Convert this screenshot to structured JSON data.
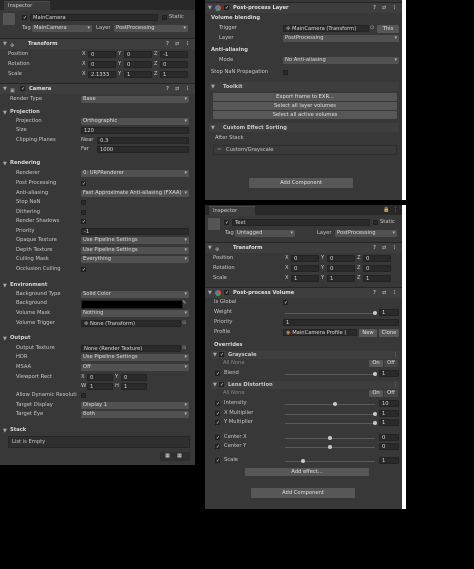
{
  "left": {
    "tab": "Inspector",
    "object": {
      "name": "MainCamera",
      "static": "Static",
      "tag_label": "Tag",
      "tag": "MainCamera",
      "layer_label": "Layer",
      "layer": "PostProcessing"
    },
    "transform": {
      "title": "Transform",
      "position": {
        "label": "Position",
        "x": "0",
        "y": "0",
        "z": "-1"
      },
      "rotation": {
        "label": "Rotation",
        "x": "0",
        "y": "0",
        "z": "0"
      },
      "scale": {
        "label": "Scale",
        "x": "2.1333",
        "y": "1",
        "z": "1"
      }
    },
    "camera": {
      "title": "Camera",
      "render_type_label": "Render Type",
      "render_type": "Base",
      "projection_header": "Projection",
      "projection_label": "Projection",
      "projection": "Orthographic",
      "size_label": "Size",
      "size": "120",
      "clipping_label": "Clipping Planes",
      "near_label": "Near",
      "near": "0.3",
      "far_label": "Far",
      "far": "1000",
      "rendering_header": "Rendering",
      "renderer_label": "Renderer",
      "renderer": "0: URPRenderer",
      "post_label": "Post Processing",
      "aa_label": "Anti-aliasing",
      "aa": "Fast Approximate Anti-aliasing (FXAA)",
      "stopnan_label": "Stop NaN",
      "dither_label": "Dithering",
      "shadows_label": "Render Shadows",
      "priority_label": "Priority",
      "priority": "-1",
      "opaque_label": "Opaque Texture",
      "opaque": "Use Pipeline Settings",
      "depth_label": "Depth Texture",
      "depth": "Use Pipeline Settings",
      "culling_label": "Culling Mask",
      "culling": "Everything",
      "occlusion_label": "Occlusion Culling",
      "environment_header": "Environment",
      "bgtype_label": "Background Type",
      "bgtype": "Solid Color",
      "bg_label": "Background",
      "volmask_label": "Volume Mask",
      "volmask": "Nothing",
      "voltrig_label": "Volume Trigger",
      "voltrig": "None (Transform)",
      "output_header": "Output",
      "outtex_label": "Output Texture",
      "outtex": "None (Render Texture)",
      "hdr_label": "HDR",
      "hdr": "Use Pipeline Settings",
      "msaa_label": "MSAA",
      "msaa": "Off",
      "viewport_label": "Viewport Rect",
      "vx": "0",
      "vy": "0",
      "vw": "1",
      "vh": "1",
      "allowdyn_label": "Allow Dynamic Resoluti",
      "tdisplay_label": "Target Display",
      "tdisplay": "Display 1",
      "teye_label": "Target Eye",
      "teye": "Both",
      "stack_header": "Stack",
      "stack_empty": "List is Empty"
    }
  },
  "right1": {
    "title": "Post-process Layer",
    "volume_blending": "Volume blending",
    "trigger_label": "Trigger",
    "trigger": "MainCamera (Transform)",
    "this_btn": "This",
    "layer_label": "Layer",
    "layer": "PostProcessing",
    "aa_header": "Anti-aliasing",
    "mode_label": "Mode",
    "mode": "No Anti-aliasing",
    "stopnan_label": "Stop NaN Propagation",
    "toolkit": "Toolkit",
    "export_btn": "Export frame to EXR...",
    "select_all_btn": "Select all layer volumes",
    "select_active_btn": "Select all active volumes",
    "custom_header": "Custom Effect Sorting",
    "after_stack": "After Stack",
    "grayscale": "Custom/Grayscale",
    "add_component": "Add Component"
  },
  "right2": {
    "tab": "Inspector",
    "object": {
      "name": "Text",
      "static": "Static",
      "tag_label": "Tag",
      "tag": "Untagged",
      "layer_label": "Layer",
      "layer": "PostProcessing"
    },
    "transform": {
      "title": "Transform",
      "position": {
        "label": "Position",
        "x": "0",
        "y": "0",
        "z": "0"
      },
      "rotation": {
        "label": "Rotation",
        "x": "0",
        "y": "0",
        "z": "0"
      },
      "scale": {
        "label": "Scale",
        "x": "1",
        "y": "1",
        "z": "1"
      }
    },
    "ppv": {
      "title": "Post-process Volume",
      "isglobal_label": "Is Global",
      "weight_label": "Weight",
      "weight": "1",
      "weight_level": 1,
      "priority_label": "Priority",
      "priority": "1",
      "profile_label": "Profile",
      "profile": "MainCamera Profile (",
      "new_btn": "New",
      "clone_btn": "Clone",
      "overrides": "Overrides",
      "grayscale": {
        "title": "Grayscale",
        "all": "All",
        "none": "None",
        "on": "On",
        "off": "Off",
        "blend_label": "Blend",
        "blend": "1",
        "blend_level": 1
      },
      "lens": {
        "title": "Lens Distortion",
        "all": "All",
        "none": "None",
        "on": "On",
        "off": "Off",
        "intensity_label": "Intensity",
        "intensity": "10",
        "intensity_level": 0.55,
        "xmul_label": "X Multiplier",
        "xmul": "1",
        "xmul_level": 1,
        "ymul_label": "Y Multiplier",
        "ymul": "1",
        "ymul_level": 1,
        "cx_label": "Center X",
        "cx": "0",
        "cx_level": 0.5,
        "cy_label": "Center Y",
        "cy": "0",
        "cy_level": 0.5,
        "scale_label": "Scale",
        "scale": "1",
        "scale_level": 0.2
      },
      "add_effect": "Add effect..."
    },
    "add_component": "Add Component"
  }
}
